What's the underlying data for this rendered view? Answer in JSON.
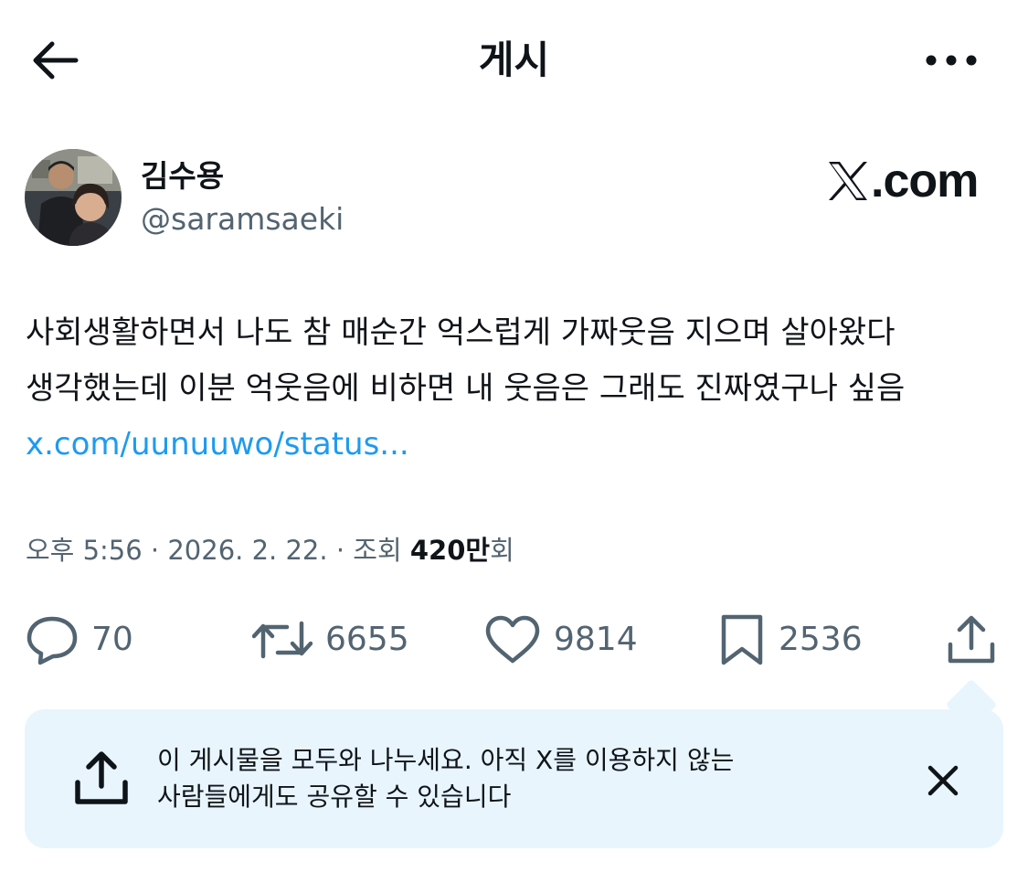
{
  "header": {
    "title": "게시",
    "back_icon": "arrow-left-icon",
    "more_icon": "more-horizontal-icon"
  },
  "author": {
    "display_name": "김수용",
    "handle": "@saramsaeki",
    "avatar_icon": "profile-photo"
  },
  "watermark": {
    "text": ".com",
    "icon": "x-logo-icon"
  },
  "tweet": {
    "text": "사회생활하면서 나도 참 매순간 억스럽게 가짜웃음 지으며 살아왔다 생각했는데 이분 억웃음에 비하면 내 웃음은 그래도 진짜였구나 싶음 ",
    "link_text": "x.com/uunuuwo/status..."
  },
  "meta": {
    "time": "오후 5:56",
    "separator": "·",
    "date": "2026. 2. 22.",
    "views_label": "조회",
    "views_count": "420만",
    "views_suffix": "회"
  },
  "actions": {
    "reply": {
      "icon": "reply-icon",
      "count": "70"
    },
    "repost": {
      "icon": "repost-icon",
      "count": "6655"
    },
    "like": {
      "icon": "heart-icon",
      "count": "9814"
    },
    "bookmark": {
      "icon": "bookmark-icon",
      "count": "2536"
    },
    "share": {
      "icon": "share-icon"
    }
  },
  "promo": {
    "line1": "이 게시물을 모두와 나누세요. 아직 X를 이용하지 않는",
    "line2": "사람들에게도 공유할 수 있습니다",
    "icon": "share-icon",
    "close_icon": "close-icon"
  },
  "colors": {
    "text": "#0f1419",
    "secondary": "#536471",
    "link": "#1d9bf0",
    "promo_bg": "#e8f5fd"
  }
}
